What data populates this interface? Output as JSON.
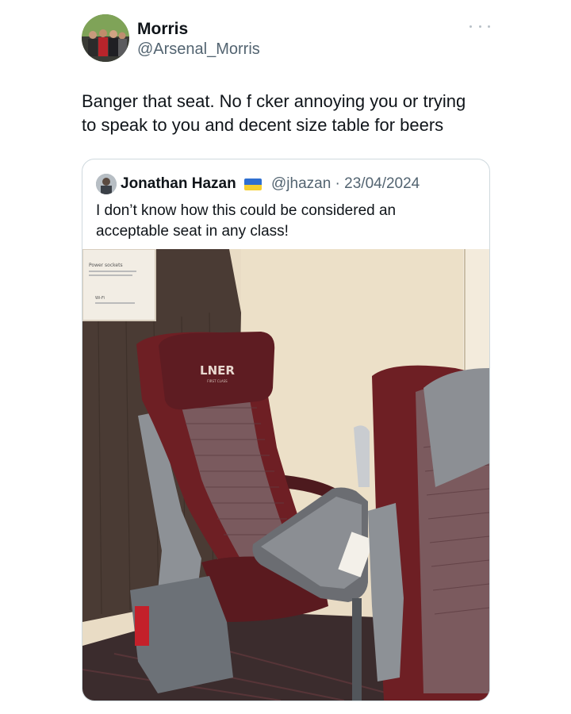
{
  "tweet": {
    "author_name": "Morris",
    "author_handle": "@Arsenal_Morris",
    "more_icon": "more-horizontal-icon",
    "text": "Banger that seat. No f   cker annoying you or trying\nto speak to you and decent size table for beers"
  },
  "quote": {
    "author_name": "Jonathan Hazan",
    "flag_icon": "ukraine-flag-icon",
    "meta": "@jhazan · 23/04/2024",
    "text": "I don’t know how this could be considered an\nacceptable seat in any class!",
    "photo": {
      "headrest_logo": "LNER",
      "headrest_sub": "FIRST CLASS",
      "notice_title": "Power sockets",
      "notice_wifi": "Wi-Fi"
    }
  },
  "colors": {
    "text_primary": "#0f1419",
    "text_secondary": "#536471",
    "border": "#cfd9de",
    "seat_red": "#6e1f24",
    "seat_grey": "#8d9196"
  }
}
